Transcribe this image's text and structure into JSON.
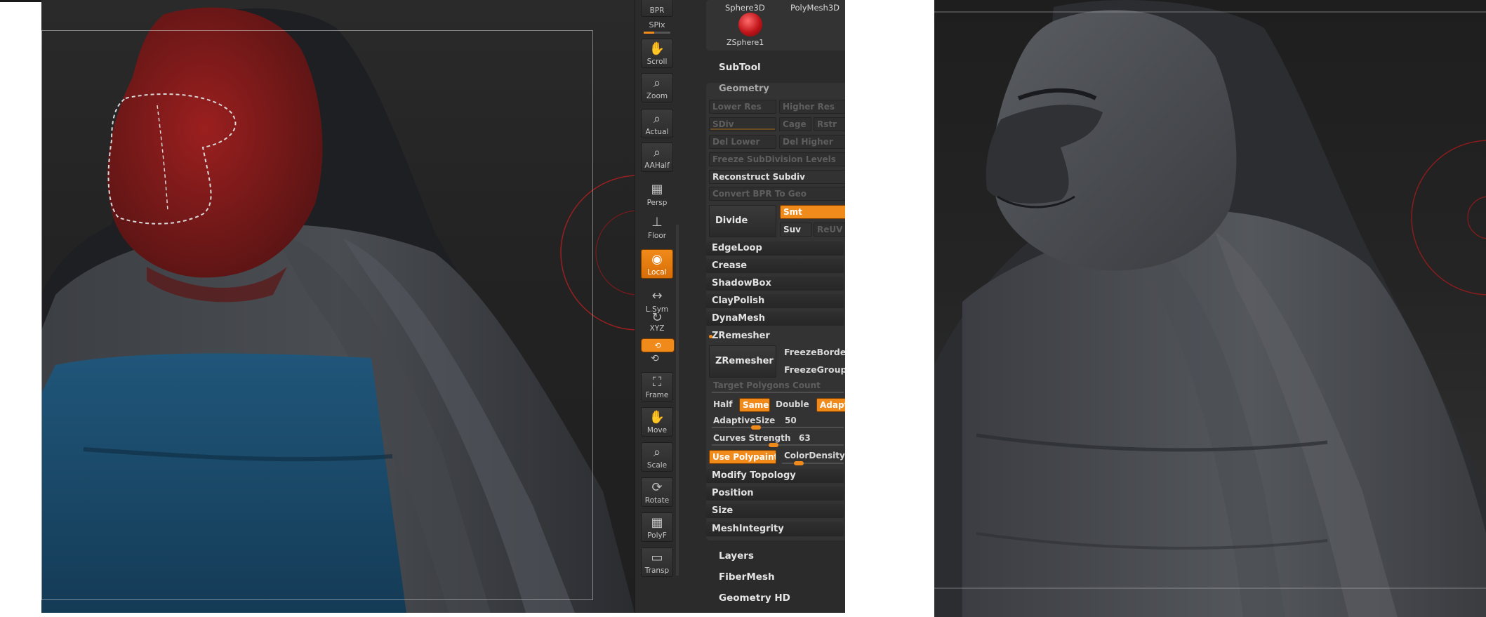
{
  "colors": {
    "accent": "#f08a1a",
    "panel_bg": "#2b2b2b",
    "sub_panel_bg": "#333333",
    "mask_red": "#8b1a1a",
    "polygroup_blue": "#1c4e6e",
    "model_gray": "#3a3c40"
  },
  "shelf": {
    "top_button": "BPR",
    "spix_label": "SPix",
    "spix_fraction": 0.4,
    "tools": [
      {
        "name": "scroll",
        "label": "Scroll",
        "icon": "hand-scroll-icon"
      },
      {
        "name": "zoom",
        "label": "Zoom",
        "icon": "magnifier-zoom-icon"
      },
      {
        "name": "actual",
        "label": "Actual",
        "icon": "magnifier-actual-icon"
      },
      {
        "name": "aahalf",
        "label": "AAHalf",
        "icon": "magnifier-aahalf-icon"
      },
      {
        "name": "persp",
        "label": "Persp",
        "icon": "grid-persp-icon"
      },
      {
        "name": "floor",
        "label": "Floor",
        "icon": "floor-icon"
      },
      {
        "name": "local",
        "label": "Local",
        "icon": "local-pivot-icon",
        "active": true
      },
      {
        "name": "lsym",
        "label": "L.Sym",
        "icon": "symmetry-arrows-icon"
      },
      {
        "name": "xyz",
        "label": "XYZ",
        "icon": "rotate-xyz-icon"
      },
      {
        "name": "frame",
        "label": "Frame",
        "icon": "frame-icon"
      },
      {
        "name": "move",
        "label": "Move",
        "icon": "hand-move-icon"
      },
      {
        "name": "scale",
        "label": "Scale",
        "icon": "magnifier-scale-icon"
      },
      {
        "name": "rotate",
        "label": "Rotate",
        "icon": "rotate-icon"
      },
      {
        "name": "polyf",
        "label": "PolyF",
        "icon": "polyframe-grid-icon"
      },
      {
        "name": "transp",
        "label": "Transp",
        "icon": "transparency-icon"
      }
    ]
  },
  "palette": {
    "thumbs": {
      "sphere3d": "Sphere3D",
      "polymesh3d": "PolyMesh3D",
      "zsphere": "ZSphere1"
    },
    "subtool": "SubTool",
    "geometry": {
      "title": "Geometry",
      "lower_res": "Lower Res",
      "higher_res": "Higher Res",
      "sdiv": "SDiv",
      "cage": "Cage",
      "rstr": "Rstr",
      "del_lower": "Del Lower",
      "del_higher": "Del Higher",
      "freeze_subdiv": "Freeze SubDivision Levels",
      "reconstruct": "Reconstruct Subdiv",
      "convert_bpr": "Convert BPR To Geo",
      "divide": "Divide",
      "smt": "Smt",
      "suv": "Suv",
      "reuv": "ReUV",
      "edgeloop": "EdgeLoop",
      "crease": "Crease",
      "shadowbox": "ShadowBox",
      "claypolish": "ClayPolish",
      "dynamesh": "DynaMesh",
      "zremesher_hdr": "ZRemesher",
      "zremesher_btn": "ZRemesher",
      "freeze_border": "FreezeBorder",
      "freeze_groups": "FreezeGroups",
      "target_polys": "Target Polygons Count",
      "half": "Half",
      "same": "Same",
      "double": "Double",
      "adapt": "Adapt",
      "adaptive_size_label": "AdaptiveSize",
      "adaptive_size": "50",
      "curves_strength_label": "Curves Strength",
      "curves_strength": "63",
      "use_polypaint": "Use Polypaint",
      "color_density": "ColorDensity",
      "modify_topology": "Modify Topology",
      "position": "Position",
      "size": "Size",
      "mesh_integrity": "MeshIntegrity"
    },
    "layers": "Layers",
    "fibermesh": "FiberMesh",
    "geometry_hd": "Geometry HD"
  }
}
